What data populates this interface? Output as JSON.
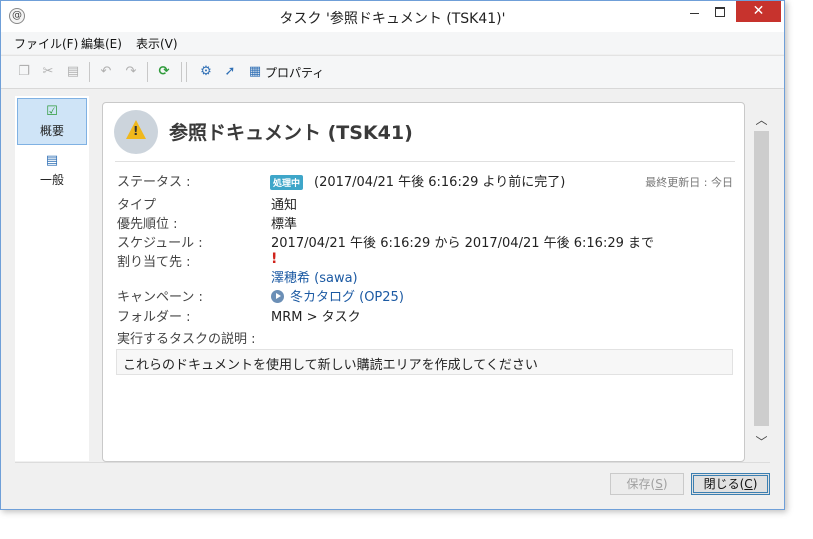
{
  "window": {
    "title": "タスク '参照ドキュメント (TSK41)'",
    "app_icon_glyph": "@",
    "close_glyph": "✕"
  },
  "menu": {
    "items": [
      "ファイル(F)",
      "編集(E)",
      "表示(V)"
    ]
  },
  "toolbar": {
    "icons": [
      "copy-icon",
      "cut-icon",
      "paste-icon",
      "undo-icon",
      "redo-icon",
      "refresh-icon",
      "gear-icon",
      "export-icon",
      "properties-icon"
    ],
    "properties_label": "プロパティ"
  },
  "sidebar": {
    "items": [
      {
        "label": "概要",
        "icon": "checklist-icon",
        "active": true
      },
      {
        "label": "一般",
        "icon": "clipboard-icon",
        "active": false
      }
    ]
  },
  "task": {
    "title": "参照ドキュメント (TSK41)",
    "status_label": "ステータス :",
    "status_badge": "処理中",
    "status_text": "(2017/04/21 午後 6:16:29 より前に完了)",
    "last_updated": "最終更新日 : 今日",
    "type_label": "タイプ",
    "type_value": "通知",
    "priority_label": "優先順位 :",
    "priority_value": "標準",
    "schedule_label": "スケジュール :",
    "schedule_value": "2017/04/21 午後 6:16:29 から 2017/04/21 午後 6:16:29 まで",
    "assignee_label": "割り当て先 :",
    "assignee_mark": "!",
    "assignee_value": "澤穂希 (sawa)",
    "campaign_label": "キャンペーン :",
    "campaign_value": "冬カタログ (OP25)",
    "folder_label": "フォルダー :",
    "folder_value": "MRM > タスク",
    "description_label": "実行するタスクの説明 :",
    "description_value": "これらのドキュメントを使用して新しい購読エリアを作成してください"
  },
  "buttons": {
    "save_text": "保存(",
    "save_key": "S",
    "save_end": ")",
    "close_text": "閉じる(",
    "close_key": "C",
    "close_end": ")"
  },
  "colors": {
    "status_badge": "#3ea6c9",
    "link": "#1c5aa3",
    "close_button": "#c7332d",
    "warning": "#f0b81c"
  }
}
